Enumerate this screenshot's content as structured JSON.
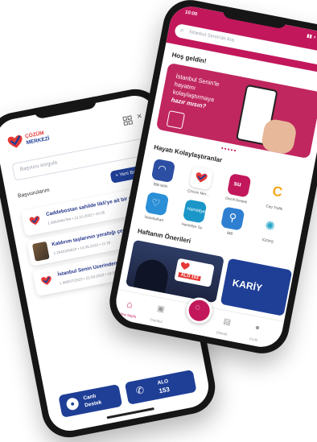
{
  "colors": {
    "brand_blue": "#1f3f96",
    "brand_pink": "#c2185b",
    "accent_red": "#e53935"
  },
  "back_phone": {
    "logo_line1": "ÇÖZÜM",
    "logo_line2": "MERKEZİ",
    "search_placeholder": "Başvuru sorgula",
    "section_title": "Başvurularım",
    "new_button": "+ Yeni Başvuru",
    "cards": [
      {
        "title": "Caddebostan sahilde likli'ye ait bir si...",
        "meta": "1.456/3457/94 • 10.10.2022 • 16:05",
        "icon": "heart-check-icon"
      },
      {
        "title": "Kaldırım taşlarının yeraltığı çevre k...",
        "meta": "1.254/02/9624 • 14.05.2022 • 11:18",
        "icon": "photo-thumb"
      },
      {
        "title": "İstanbul Senin Uzerinden Hamid...",
        "meta": "1.465/07/2023 • 22.03.2023 • 16:30",
        "icon": "heart-check-icon"
      }
    ],
    "live_support": {
      "line1": "Canlı",
      "line2": "Destek"
    },
    "alo": {
      "line1": "ALO",
      "line2": "153"
    }
  },
  "front_phone": {
    "status_time": "10:00",
    "search_placeholder": "İstanbul Senin'de Ara",
    "greeting": "Hoş geldin!",
    "banner_text": [
      "İstanbul Senin'le",
      "hayatını",
      "kolaylaştırmaya",
      "hazır mısın?"
    ],
    "section_quick": "Hayatı Kolaylaştıranlar",
    "quick_actions": [
      {
        "label": "İBB WiFi",
        "icon": "wifi-icon",
        "color": "#2c4fa3"
      },
      {
        "label": "Çözüm Mer...",
        "icon": "heart-check-icon",
        "color": "#ffffff"
      },
      {
        "label": "Demli Destek",
        "icon": "su-icon",
        "color": "#c2185b"
      },
      {
        "label": "Cep Trafik",
        "icon": "c-icon",
        "color": "#ffffff"
      },
      {
        "label": "İstanbulkart",
        "icon": "heart-icon",
        "color": "#2a8fd6"
      },
      {
        "label": "Hamidiye Su",
        "icon": "hamidiye-icon",
        "color": "#1a96c8"
      },
      {
        "label": "İBB",
        "icon": "paperclip-icon",
        "color": "#2e7fd1"
      },
      {
        "label": "İGDAŞ",
        "icon": "gear-flower-icon",
        "color": "#ffffff"
      }
    ],
    "section_suggest": "Haftanın Önerileri",
    "suggest_badge": "ALO 153",
    "suggest2": "KARİY",
    "nav": [
      "Ana Sayfa",
      "İstanbul",
      "",
      "Etkinlik",
      "Profil"
    ]
  }
}
